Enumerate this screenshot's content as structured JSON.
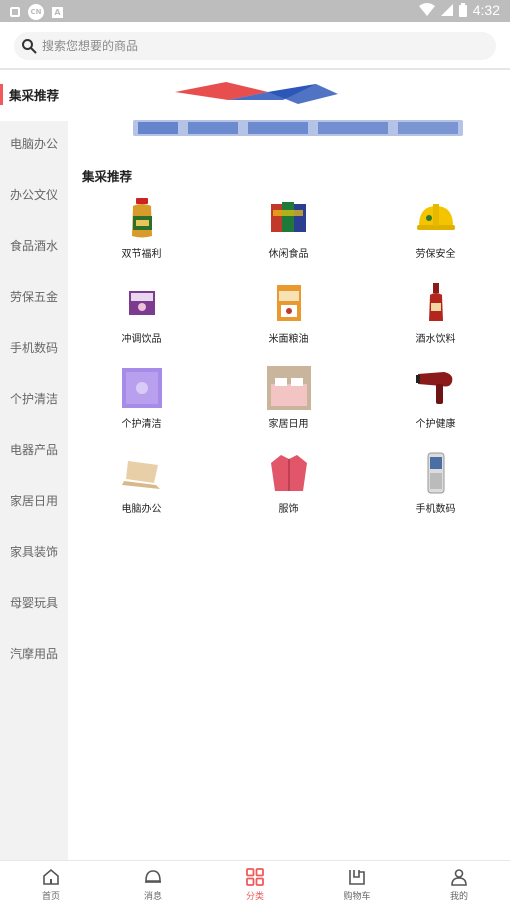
{
  "status_bar": {
    "time": "4:32",
    "cc_badge": "CN",
    "a_badge": "A"
  },
  "search": {
    "placeholder": "搜索您想要的商品"
  },
  "sidebar": {
    "items": [
      {
        "label": "集采推荐",
        "active": true
      },
      {
        "label": "电脑办公"
      },
      {
        "label": "办公文仪"
      },
      {
        "label": "食品酒水"
      },
      {
        "label": "劳保五金"
      },
      {
        "label": "手机数码"
      },
      {
        "label": "个护清洁"
      },
      {
        "label": "电器产品"
      },
      {
        "label": "家居日用"
      },
      {
        "label": "家具装饰"
      },
      {
        "label": "母婴玩具"
      },
      {
        "label": "汽摩用品"
      }
    ]
  },
  "main": {
    "section_title": "集采推荐",
    "categories": [
      {
        "label": "双节福利",
        "icon": "oil-bottle-icon"
      },
      {
        "label": "休闲食品",
        "icon": "snack-pack-icon"
      },
      {
        "label": "劳保安全",
        "icon": "safety-helmet-icon"
      },
      {
        "label": "冲调饮品",
        "icon": "drink-box-icon"
      },
      {
        "label": "米面粮油",
        "icon": "rice-bag-icon"
      },
      {
        "label": "酒水饮料",
        "icon": "wine-bottle-icon"
      },
      {
        "label": "个护清洁",
        "icon": "cleaning-pack-icon"
      },
      {
        "label": "家居日用",
        "icon": "bedding-icon"
      },
      {
        "label": "个护健康",
        "icon": "hair-dryer-icon"
      },
      {
        "label": "电脑办公",
        "icon": "laptop-icon"
      },
      {
        "label": "服饰",
        "icon": "jacket-icon"
      },
      {
        "label": "手机数码",
        "icon": "phone-icon"
      }
    ]
  },
  "tab_bar": {
    "tabs": [
      {
        "label": "首页",
        "icon": "home-icon"
      },
      {
        "label": "消息",
        "icon": "message-icon"
      },
      {
        "label": "分类",
        "icon": "category-icon",
        "active": true
      },
      {
        "label": "购物车",
        "icon": "cart-icon"
      },
      {
        "label": "我的",
        "icon": "profile-icon"
      }
    ]
  },
  "colors": {
    "accent": "#f05a5a",
    "sidebar_bg": "#f2f2f2",
    "status_bar": "#bdbdbd"
  }
}
